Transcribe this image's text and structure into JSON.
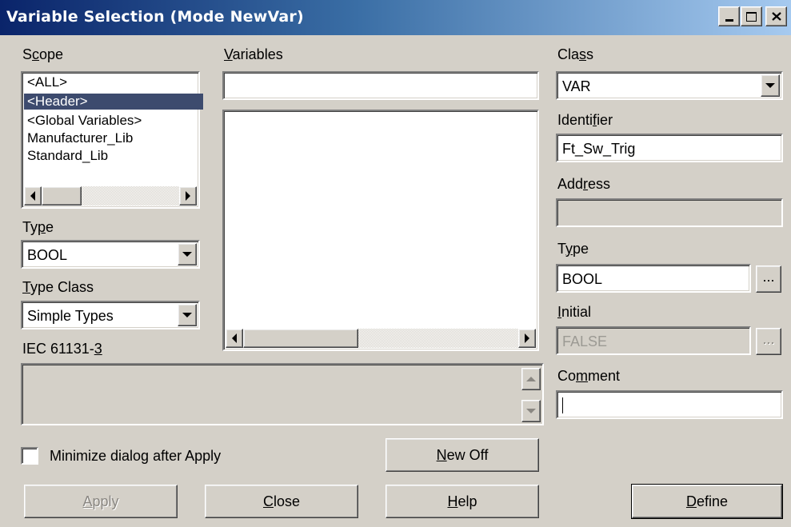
{
  "window": {
    "title": "Variable Selection (Mode NewVar)"
  },
  "scope": {
    "label_pre": "S",
    "label_ul": "c",
    "label_post": "ope",
    "items": [
      "<ALL>",
      "<Header>",
      "<Global Variables>",
      "Manufacturer_Lib",
      "Standard_Lib"
    ],
    "selected_index": 1
  },
  "variables": {
    "label_ul": "V",
    "label_post": "ariables",
    "filter_value": ""
  },
  "left_type": {
    "label_pre": "Ty",
    "label_ul": "p",
    "label_post": "e",
    "value": "BOOL"
  },
  "type_class": {
    "label_ul": "T",
    "label_post": "ype Class",
    "value": "Simple Types"
  },
  "iec": {
    "label_pre": "IEC 61131-",
    "label_ul": "3",
    "description": ""
  },
  "class_field": {
    "label_pre": "Cla",
    "label_ul": "s",
    "label_post": "s",
    "value": "VAR"
  },
  "identifier": {
    "label_pre": "Identi",
    "label_ul": "f",
    "label_post": "ier",
    "value": "Ft_Sw_Trig"
  },
  "address": {
    "label_pre": "Add",
    "label_ul": "r",
    "label_post": "ess",
    "value": ""
  },
  "right_type": {
    "label_pre": "T",
    "label_ul": "y",
    "label_post": "pe",
    "value": "BOOL",
    "browse_label": "..."
  },
  "initial": {
    "label_ul": "I",
    "label_post": "nitial",
    "value": "FALSE",
    "browse_label": "..."
  },
  "comment": {
    "label_pre": "Co",
    "label_ul": "m",
    "label_post": "ment",
    "value": ""
  },
  "minimize": {
    "label_pre": "Minimize dialo",
    "label_ul": "g",
    "label_post": " after Apply",
    "checked": false
  },
  "buttons": {
    "new_off": {
      "ul": "N",
      "rest": "ew Off"
    },
    "apply": {
      "ul": "A",
      "rest": "pply"
    },
    "close": {
      "ul": "C",
      "rest": "lose"
    },
    "help": {
      "ul": "H",
      "rest": "elp"
    },
    "define": {
      "ul": "D",
      "rest": "efine"
    }
  },
  "colors": {
    "dialog_bg": "#d4d0c8",
    "title_start": "#0a246a",
    "title_end": "#a6caf0",
    "selection": "#3d4b6e"
  }
}
